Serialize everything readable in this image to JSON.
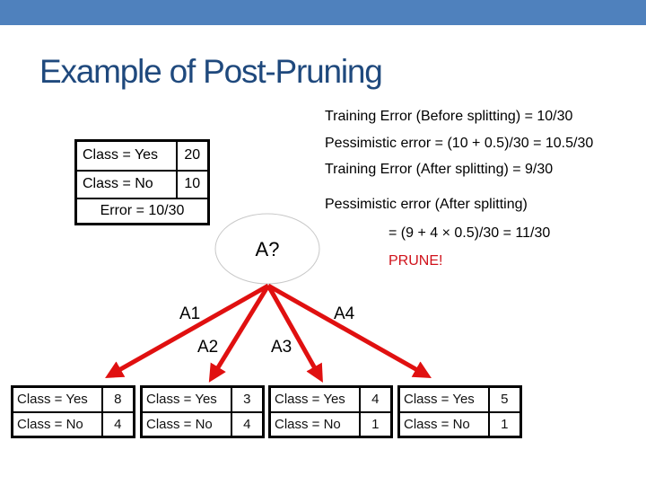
{
  "slide": {
    "title": "Example of Post-Pruning",
    "accent_color": "#4F81BD",
    "title_color": "#1F497D"
  },
  "calculations": {
    "training_error_before": "Training Error (Before splitting) = 10/30",
    "pessimistic_error_before": "Pessimistic error = (10 + 0.5)/30 = 10.5/30",
    "training_error_after": "Training Error (After splitting) = 9/30",
    "pessimistic_error_after_label": "Pessimistic error (After splitting)",
    "pessimistic_error_after_value": "= (9 + 4 × 0.5)/30 = 11/30",
    "verdict": "PRUNE!",
    "verdict_color": "#D0121B"
  },
  "root_node": {
    "rows": [
      {
        "label": "Class = Yes",
        "count": "20"
      },
      {
        "label": "Class = No",
        "count": "10"
      }
    ],
    "error": "Error = 10/30",
    "split_label": "A?"
  },
  "edges": [
    {
      "label": "A1"
    },
    {
      "label": "A2"
    },
    {
      "label": "A3"
    },
    {
      "label": "A4"
    }
  ],
  "edge_color": "#E01010",
  "leaves": [
    {
      "rows": [
        {
          "label": "Class = Yes",
          "count": "8"
        },
        {
          "label": "Class = No",
          "count": "4"
        }
      ]
    },
    {
      "rows": [
        {
          "label": "Class = Yes",
          "count": "3"
        },
        {
          "label": "Class = No",
          "count": "4"
        }
      ]
    },
    {
      "rows": [
        {
          "label": "Class = Yes",
          "count": "4"
        },
        {
          "label": "Class = No",
          "count": "1"
        }
      ]
    },
    {
      "rows": [
        {
          "label": "Class = Yes",
          "count": "5"
        },
        {
          "label": "Class = No",
          "count": "1"
        }
      ]
    }
  ]
}
